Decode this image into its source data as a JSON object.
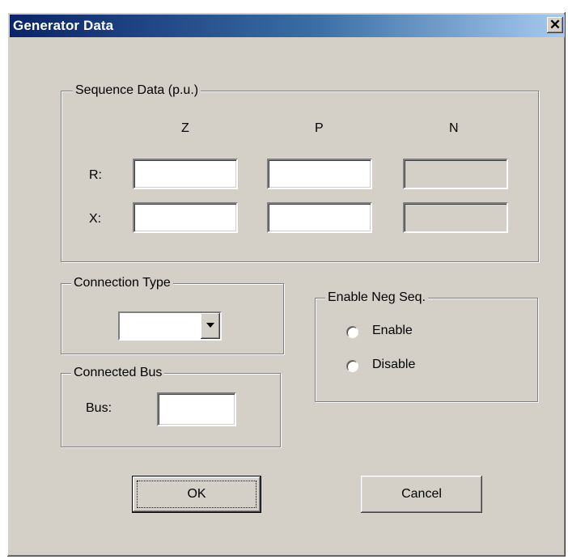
{
  "window": {
    "title": "Generator Data",
    "close_glyph": "✕"
  },
  "sequence": {
    "legend": "Sequence Data (p.u.)",
    "columns": [
      "Z",
      "P",
      "N"
    ],
    "rows": [
      "R:",
      "X:"
    ],
    "values": {
      "R_Z": "",
      "R_P": "",
      "R_N": "",
      "X_Z": "",
      "X_P": "",
      "X_N": ""
    }
  },
  "connection": {
    "legend": "Connection Type",
    "selected": ""
  },
  "bus": {
    "legend": "Connected Bus",
    "label": "Bus:",
    "value": ""
  },
  "negseq": {
    "legend": "Enable Neg Seq.",
    "options": [
      "Enable",
      "Disable"
    ]
  },
  "buttons": {
    "ok": "OK",
    "cancel": "Cancel"
  },
  "icons": {
    "close": "close-icon",
    "dropdown": "chevron-down-icon",
    "radio": "radio-icon"
  }
}
